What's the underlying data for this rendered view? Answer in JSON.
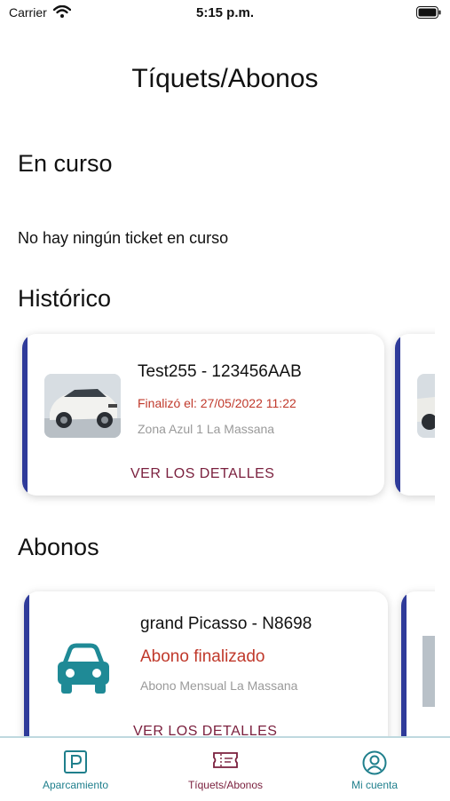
{
  "status_bar": {
    "carrier": "Carrier",
    "time": "5:15 p.m."
  },
  "header": {
    "title": "Tíquets/Abonos"
  },
  "en_curso": {
    "heading": "En curso",
    "empty_message": "No hay ningún ticket en curso"
  },
  "historico": {
    "heading": "Histórico",
    "cards": [
      {
        "title": "Test255 - 123456AAB",
        "status": "Finalizó el: 27/05/2022 11:22",
        "zone": "Zona Azul 1 La Massana",
        "action": "VER LOS DETALLES"
      }
    ]
  },
  "abonos": {
    "heading": "Abonos",
    "cards": [
      {
        "title": "grand Picasso - N8698",
        "status": "Abono finalizado",
        "zone": "Abono Mensual La Massana",
        "action": "VER LOS DETALLES"
      }
    ]
  },
  "tab_bar": {
    "items": [
      {
        "label": "Aparcamiento",
        "icon": "parking-icon"
      },
      {
        "label": "Tíquets/Abonos",
        "icon": "ticket-icon"
      },
      {
        "label": "Mi cuenta",
        "icon": "user-icon"
      }
    ]
  },
  "colors": {
    "accent": "#2f3b9a",
    "teal": "#1f7f8c",
    "status_red": "#c0392b",
    "link": "#7a1f3d"
  }
}
